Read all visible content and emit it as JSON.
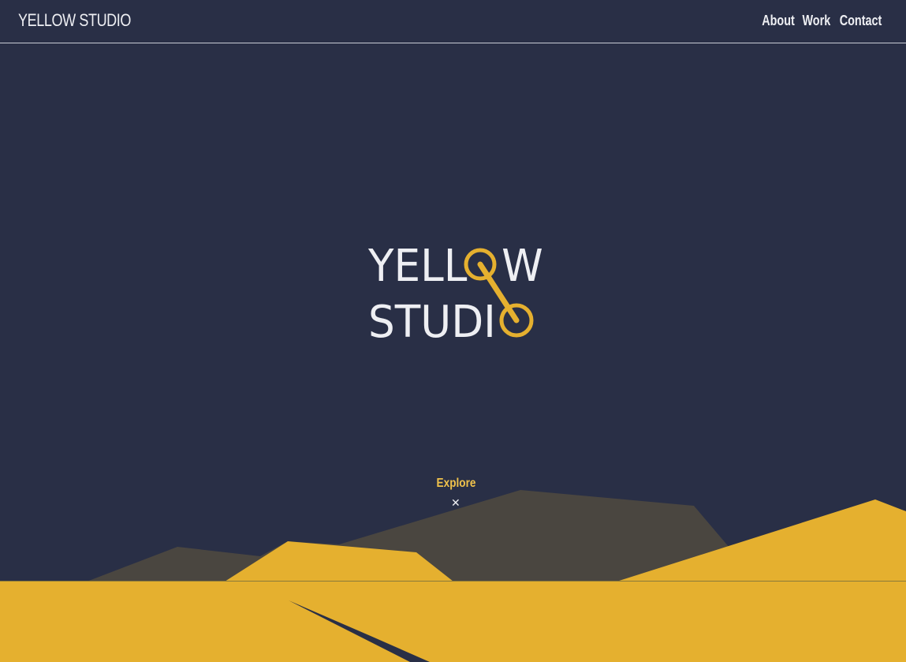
{
  "header": {
    "brand": "YELLOW STUDIO",
    "nav": [
      {
        "label": "About"
      },
      {
        "label": "Work"
      },
      {
        "label": "Contact"
      }
    ]
  },
  "hero": {
    "logo_line1": "YELL",
    "logo_line1_end": "W",
    "logo_line2": "STUDI",
    "explore_label": "Explore",
    "explore_icon": "chevron-down-icon"
  },
  "colors": {
    "background": "#292f46",
    "accent": "#e5b02f",
    "mountain_dark": "#4a4640",
    "text": "#eeeff3"
  }
}
